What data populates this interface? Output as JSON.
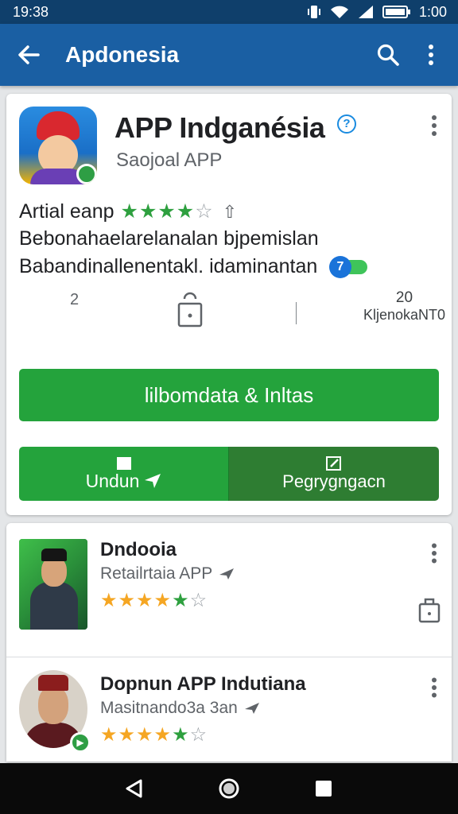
{
  "status_bar": {
    "time": "19:38",
    "battery_time": "1:00"
  },
  "app_bar": {
    "title": "Apdonesia"
  },
  "app": {
    "title": "APP Indganésia",
    "developer": "Saojoal APP",
    "rating_label": "Artial eanp",
    "rating_stars": 4,
    "description_line1": "Bebonahaelarelanalan bjpemislan",
    "description_line2": "Babandinallenentakl. idaminantan",
    "toggle_value": "7",
    "stat_left": "2",
    "stat_right_number": "20",
    "stat_right_label": "KljenokaNT0",
    "install_label": "lilbomdata & Inltas",
    "button_left_label": "Undun",
    "button_right_label": "Pegrygngacn"
  },
  "list": [
    {
      "title": "Dndooia",
      "subtitle": "Retailrtaia APP",
      "stars": 4.5
    },
    {
      "title": "Dopnun APP Indutiana",
      "subtitle": "Masitnando3a 3an",
      "stars": 4.5
    }
  ]
}
